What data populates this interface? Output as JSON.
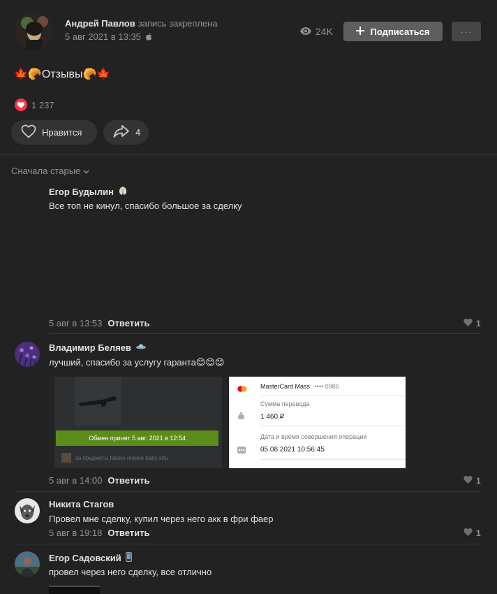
{
  "post": {
    "author": "Андрей Павлов",
    "pinned_note": "запись закреплена",
    "date": "5 авг 2021 в 13:35",
    "views": "24K",
    "subscribe_label": "Подписаться",
    "more_label": "···",
    "text": "🍁🥐Отзывы🥐🍁",
    "reactions_count": "1 237",
    "like_label": "Нравится",
    "share_count": "4"
  },
  "sort_label": "Сначала старые",
  "comments": [
    {
      "author": "Егор Будылин",
      "text": "Все топ не кинул, спасибо большое за сделку",
      "date": "5 авг в 13:53",
      "reply": "Ответить",
      "likes": "1"
    },
    {
      "author": "Владимир Беляев",
      "text": "лучший, спасибо за услугу гаранта😊😊😊",
      "date": "5 авг в 14:00",
      "reply": "Ответить",
      "likes": "1",
      "attachments": {
        "trade_text": "Обмен принят 5 авг. 2021 в 12:54",
        "trade_footer": "За предметы haters maybe baby stfu",
        "card_name": "MasterCard Mass",
        "card_mask": "•••• 0986",
        "amount_label": "Сумма перевода",
        "amount": "1 460 ₽",
        "datetime_label": "Дата и время совершения операции",
        "datetime": "05.08.2021 10:56:45"
      }
    },
    {
      "author": "Никита Стагов",
      "text": "Провел мне сделку, купил через него акк в фри фаер",
      "date": "5 авг в 19:18",
      "reply": "Ответить",
      "likes": "1"
    },
    {
      "author": "Егор Садовский",
      "text": "провел через него сделку, все отлично"
    }
  ],
  "colors": {
    "background": "#222222",
    "text": "#e1e3e6",
    "secondary": "#939393",
    "heart": "#ff3347",
    "trade_green": "#5c8d1b"
  }
}
